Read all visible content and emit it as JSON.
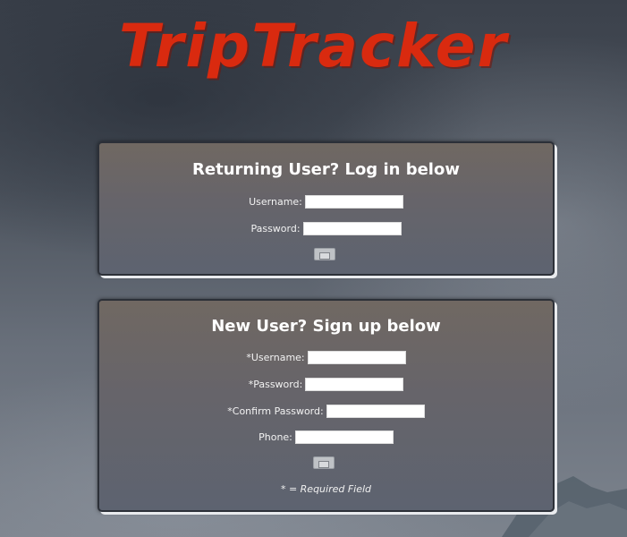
{
  "app": {
    "logo_text": "TripTracker"
  },
  "login": {
    "title": "Returning User? Log in below",
    "username_label": "Username:",
    "username_value": "",
    "password_label": "Password:",
    "password_value": "",
    "submit_icon": "submit-icon"
  },
  "signup": {
    "title": "New User? Sign up below",
    "username_label": "*Username:",
    "username_value": "",
    "password_label": "*Password:",
    "password_value": "",
    "confirm_password_label": "*Confirm Password:",
    "confirm_password_value": "",
    "phone_label": "Phone:",
    "phone_value": "",
    "submit_icon": "submit-icon",
    "required_note": "* = Required Field"
  },
  "colors": {
    "logo": "#d92a0f",
    "panel_top": "#706862",
    "panel_bottom": "#5d6370",
    "text": "#ffffff"
  }
}
